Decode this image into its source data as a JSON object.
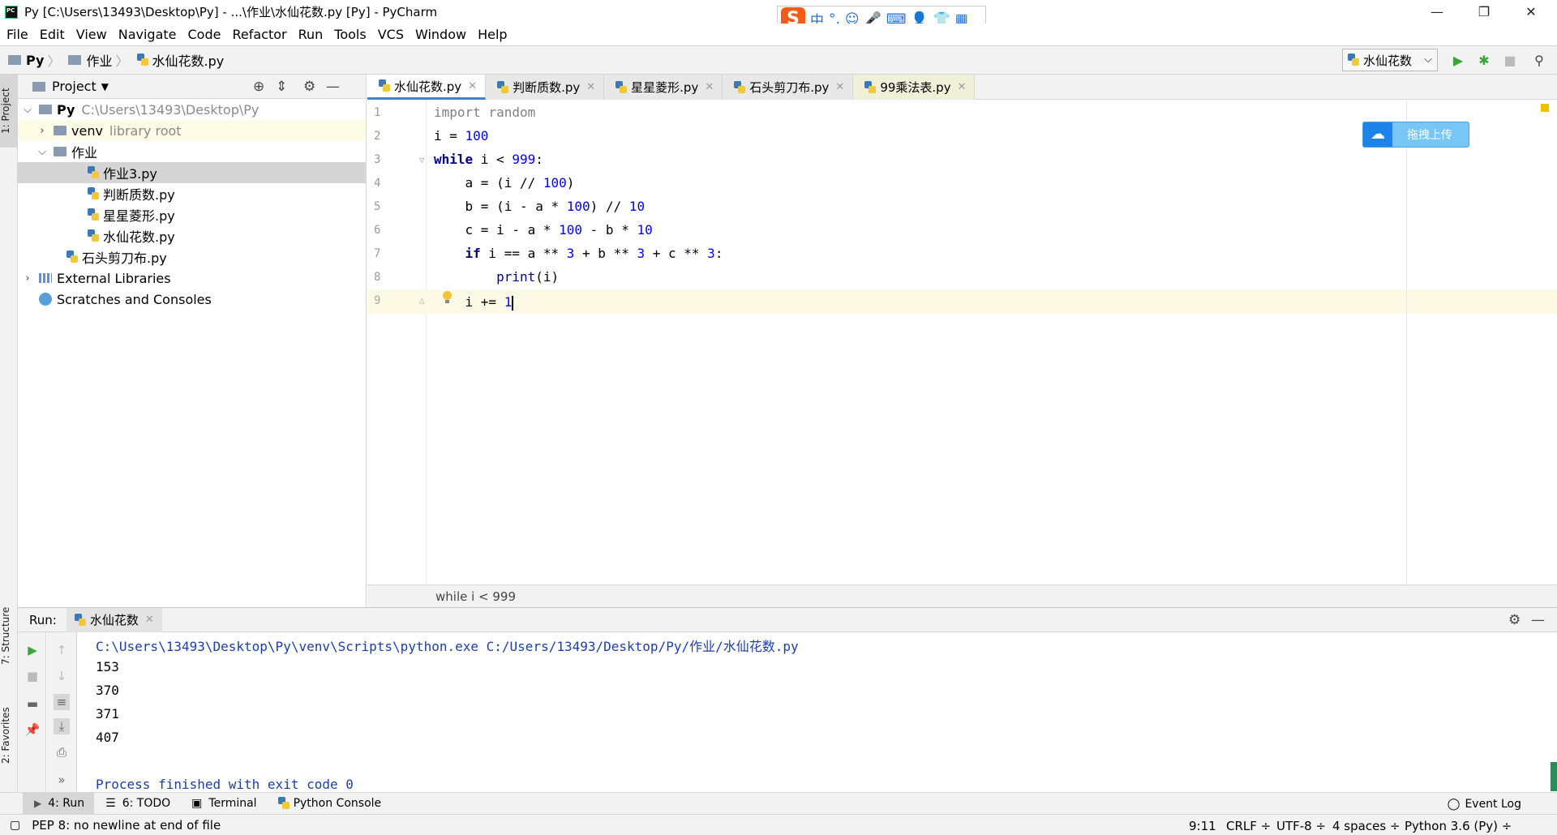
{
  "window": {
    "title": "Py [C:\\Users\\13493\\Desktop\\Py] - ...\\作业\\水仙花数.py [Py] - PyCharm",
    "minimize": "—",
    "restore": "❐",
    "close": "✕"
  },
  "ime": {
    "logo": "S",
    "items": [
      "中",
      "°,",
      "☺",
      "🎤",
      "⌨",
      "👤",
      "👕",
      "▦"
    ]
  },
  "menu": [
    "File",
    "Edit",
    "View",
    "Navigate",
    "Code",
    "Refactor",
    "Run",
    "Tools",
    "VCS",
    "Window",
    "Help"
  ],
  "nav": {
    "crumbs": [
      "Py",
      "作业",
      "水仙花数.py"
    ],
    "run_config": "水仙花数"
  },
  "left_stripe": {
    "project": "1: Project",
    "structure": "7: Structure",
    "favorites": "2: Favorites"
  },
  "project": {
    "header": "Project",
    "root": {
      "name": "Py",
      "path": "C:\\Users\\13493\\Desktop\\Py"
    },
    "venv": {
      "name": "venv",
      "note": "library root"
    },
    "folder": "作业",
    "files_in_folder": [
      "作业3.py",
      "判断质数.py",
      "星星菱形.py",
      "水仙花数.py"
    ],
    "root_file": "石头剪刀布.py",
    "external": "External Libraries",
    "scratches": "Scratches and Consoles"
  },
  "editor": {
    "tabs": [
      "水仙花数.py",
      "判断质数.py",
      "星星菱形.py",
      "石头剪刀布.py",
      "99乘法表.py"
    ],
    "line_numbers": [
      "1",
      "2",
      "3",
      "4",
      "5",
      "6",
      "7",
      "8",
      "9"
    ],
    "upload_label": "拖拽上传",
    "breadcrumb": "while i < 999"
  },
  "run": {
    "label": "Run:",
    "tab": "水仙花数",
    "output": [
      "C:\\Users\\13493\\Desktop\\Py\\venv\\Scripts\\python.exe C:/Users/13493/Desktop/Py/作业/水仙花数.py",
      "153",
      "370",
      "371",
      "407",
      "",
      "Process finished with exit code 0"
    ]
  },
  "bottom_tools": [
    "4: Run",
    "6: TODO",
    "Terminal",
    "Python Console"
  ],
  "event_log": "Event Log",
  "status": {
    "message": "PEP 8: no newline at end of file",
    "position": "9:11",
    "line_sep": "CRLF ÷",
    "encoding": "UTF-8 ÷",
    "indent": "4 spaces ÷",
    "interpreter": "Python 3.6 (Py) ÷"
  },
  "colors": {
    "accent": "#4083c9",
    "keyword": "#000080",
    "number": "#0000ff",
    "run_green": "#3ba53b"
  }
}
